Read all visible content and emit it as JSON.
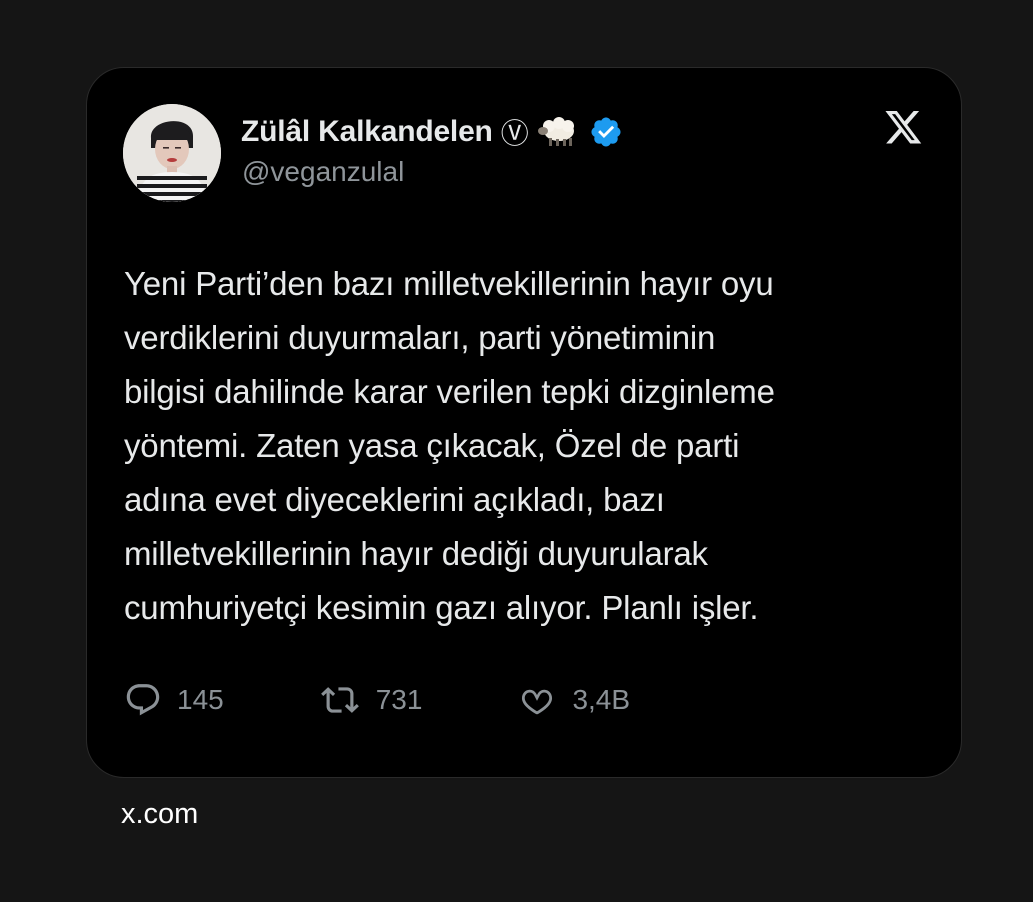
{
  "user": {
    "display_name": "Zülâl Kalkandelen",
    "name_badge": "Ⓥ",
    "handle": "@veganzulal",
    "emoji": "sheep-emoji",
    "verified": "verified-badge-icon",
    "avatar": "profile-photo"
  },
  "brand": {
    "logo": "x-logo-icon"
  },
  "tweet": {
    "text": "Yeni Parti’den bazı milletvekillerinin hayır oyu\nverdiklerini duyurmaları, parti yönetiminin\nbilgisi dahilinde karar verilen tepki dizginleme\nyöntemi. Zaten yasa çıkacak, Özel de parti\nadına evet diyeceklerini açıkladı, bazı\nmilletvekillerinin hayır dediği duyurularak\ncumhuriyetçi kesimin gazı alıyor. Planlı işler."
  },
  "actions": {
    "replies": {
      "icon": "reply-icon",
      "count": "145"
    },
    "retweets": {
      "icon": "retweet-icon",
      "count": "731"
    },
    "likes": {
      "icon": "heart-icon",
      "count": "3,4B"
    }
  },
  "footer": {
    "source": "x.com"
  },
  "colors": {
    "page_background": "#151515",
    "card_background": "#000000",
    "primary_text": "#e7e9ea",
    "secondary_text": "#8f959a",
    "verified_blue": "#1d9bf0"
  }
}
